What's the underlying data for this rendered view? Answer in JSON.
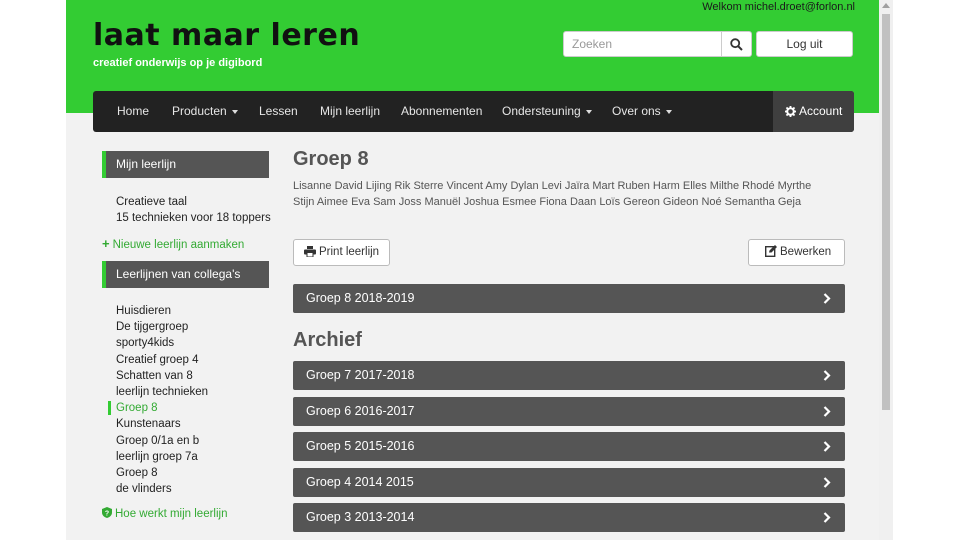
{
  "header": {
    "welcome": "Welkom michel.droet@forlon.nl",
    "logo": "laat maar leren",
    "tagline": "creatief onderwijs op je digibord",
    "search_placeholder": "Zoeken",
    "logout": "Log uit"
  },
  "nav": {
    "items": [
      {
        "label": "Home",
        "dropdown": false
      },
      {
        "label": "Producten",
        "dropdown": true
      },
      {
        "label": "Lessen",
        "dropdown": false
      },
      {
        "label": "Mijn leerlijn",
        "dropdown": false
      },
      {
        "label": "Abonnementen",
        "dropdown": false
      },
      {
        "label": "Ondersteuning",
        "dropdown": true
      },
      {
        "label": "Over ons",
        "dropdown": true
      }
    ],
    "account": "Account"
  },
  "sidebar": {
    "my_heading": "Mijn leerlijn",
    "my_items": [
      "Creatieve taal",
      "15 technieken voor 18 toppers"
    ],
    "new_link": "Nieuwe leerlijn aanmaken",
    "colleagues_heading": "Leerlijnen van collega's",
    "colleague_items": [
      "Huisdieren",
      "De tijgergroep",
      "sporty4kids",
      "Creatief groep 4",
      "Schatten van 8",
      "leerlijn technieken",
      "Groep 8",
      "Kunstenaars",
      "Groep 0/1a en b",
      "leerlijn groep 7a",
      "Groep 8",
      "de vlinders"
    ],
    "active_index": 6,
    "help_link": "Hoe werkt mijn leerlijn"
  },
  "main": {
    "title": "Groep 8",
    "students_line1": "Lisanne David Lijing Rik Sterre Vincent Amy Dylan Levi Jaïra Mart Ruben Harm Elles Milthe Rhodé Myrthe",
    "students_line2": "Stijn Aimee Eva Sam Joss Manuël Joshua Esmee Fiona Daan Loïs Gereon Gideon Noé Semantha Geja",
    "print_button": "Print leerlijn",
    "edit_button": "Bewerken",
    "current_group": "Groep 8 2018-2019",
    "archive_title": "Archief",
    "archive": [
      "Groep 7 2017-2018",
      "Groep 6 2016-2017",
      "Groep 5 2015-2016",
      "Groep 4 2014 2015",
      "Groep 3 2013-2014"
    ]
  },
  "colors": {
    "brand_green": "#33cc33",
    "nav_dark": "#222222",
    "bar_grey": "#555555"
  }
}
